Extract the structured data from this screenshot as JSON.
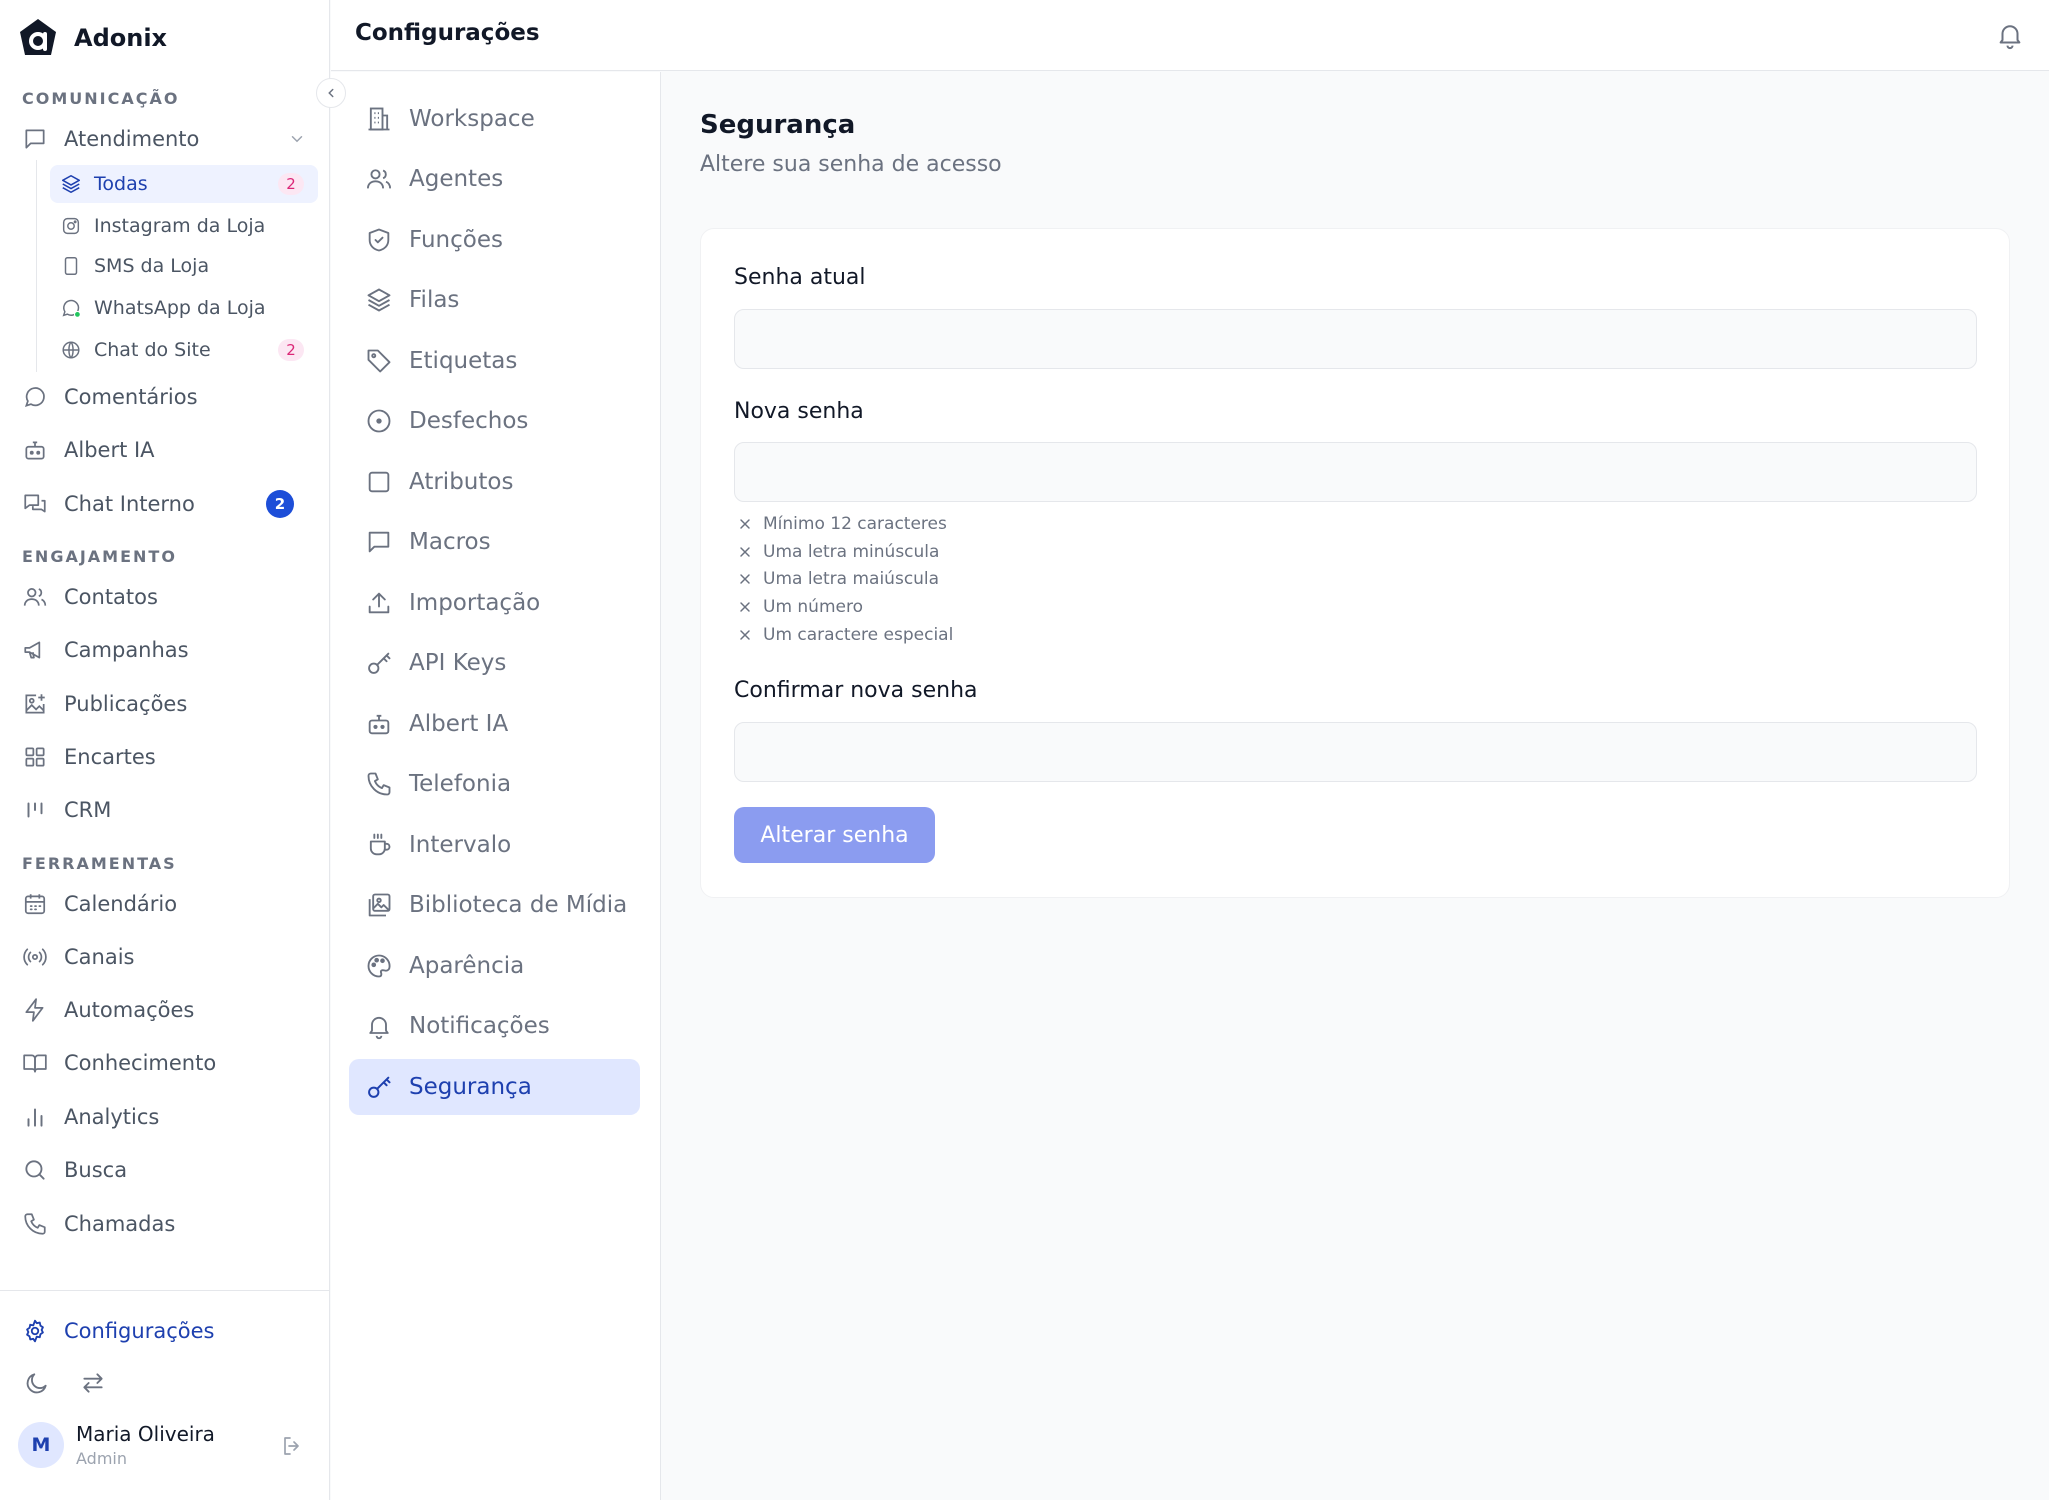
{
  "brand": {
    "name": "Adonix"
  },
  "sidebar": {
    "sections": {
      "comunicacao": "COMUNICAÇÃO",
      "engajamento": "ENGAJAMENTO",
      "ferramentas": "FERRAMENTAS"
    },
    "atendimento": {
      "label": "Atendimento",
      "subitems": [
        {
          "label": "Todas",
          "badge": "2"
        },
        {
          "label": "Instagram da Loja"
        },
        {
          "label": "SMS da Loja"
        },
        {
          "label": "WhatsApp da Loja"
        },
        {
          "label": "Chat do Site",
          "badge": "2"
        }
      ]
    },
    "comunicacao_items": [
      {
        "label": "Comentários"
      },
      {
        "label": "Albert IA"
      },
      {
        "label": "Chat Interno",
        "badge": "2"
      }
    ],
    "engajamento_items": [
      {
        "label": "Contatos"
      },
      {
        "label": "Campanhas"
      },
      {
        "label": "Publicações"
      },
      {
        "label": "Encartes"
      },
      {
        "label": "CRM"
      }
    ],
    "ferramentas_items": [
      {
        "label": "Calendário"
      },
      {
        "label": "Canais"
      },
      {
        "label": "Automações"
      },
      {
        "label": "Conhecimento"
      },
      {
        "label": "Analytics"
      },
      {
        "label": "Busca"
      },
      {
        "label": "Chamadas"
      }
    ],
    "settings_label": "Configurações",
    "user": {
      "initial": "M",
      "name": "Maria Oliveira",
      "role": "Admin"
    }
  },
  "header": {
    "title": "Configurações"
  },
  "settings_nav": [
    {
      "label": "Workspace"
    },
    {
      "label": "Agentes"
    },
    {
      "label": "Funções"
    },
    {
      "label": "Filas"
    },
    {
      "label": "Etiquetas"
    },
    {
      "label": "Desfechos"
    },
    {
      "label": "Atributos"
    },
    {
      "label": "Macros"
    },
    {
      "label": "Importação"
    },
    {
      "label": "API Keys"
    },
    {
      "label": "Albert IA"
    },
    {
      "label": "Telefonia"
    },
    {
      "label": "Intervalo"
    },
    {
      "label": "Biblioteca de Mídia"
    },
    {
      "label": "Aparência"
    },
    {
      "label": "Notificações"
    },
    {
      "label": "Segurança"
    }
  ],
  "main": {
    "title": "Segurança",
    "subtitle": "Altere sua senha de acesso",
    "form": {
      "current_label": "Senha atual",
      "current_value": "",
      "new_label": "Nova senha",
      "new_value": "",
      "requirements": [
        "Mínimo 12 caracteres",
        "Uma letra minúscula",
        "Uma letra maiúscula",
        "Um número",
        "Um caractere especial"
      ],
      "confirm_label": "Confirmar nova senha",
      "confirm_value": "",
      "submit_label": "Alterar senha"
    }
  },
  "colors": {
    "accent": "#1e40af",
    "active_bg": "#e0e7ff",
    "button_disabled": "#8b9cf0",
    "badge_pink": "#db2777",
    "badge_blue": "#1d4ed8"
  }
}
